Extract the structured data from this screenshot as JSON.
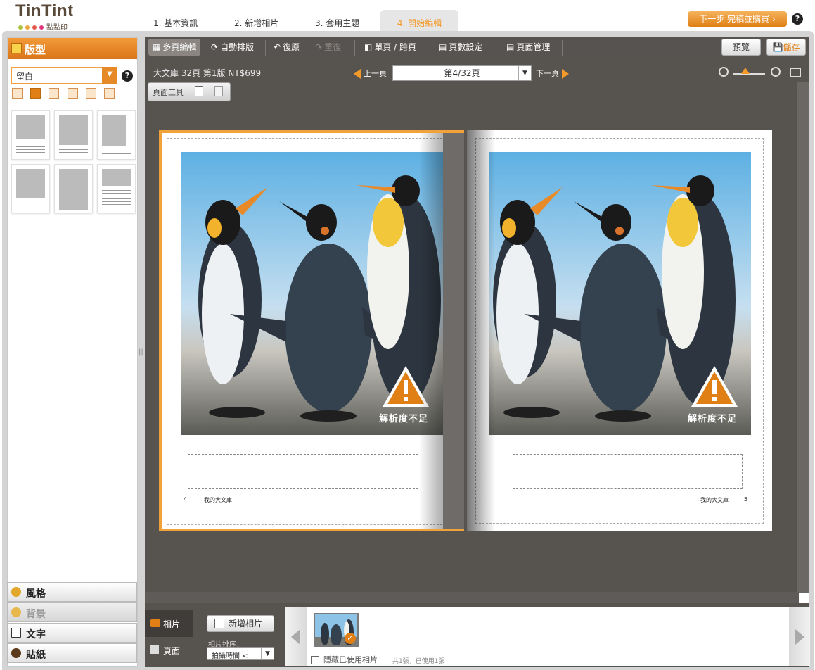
{
  "header": {
    "logo_text": "TinTint",
    "logo_sub": "點點印",
    "steps": [
      "1. 基本資訊",
      "2. 新增相片",
      "3. 套用主題",
      "4. 開始編輯"
    ],
    "next_button": "下一步 完稿並購買 ›",
    "help": "?"
  },
  "left_panel": {
    "title": "版型",
    "layout_value": "留白",
    "help": "?",
    "accordion": [
      "風格",
      "背景",
      "文字",
      "貼紙"
    ]
  },
  "toolbar": {
    "multi_edit": "多頁編輯",
    "auto_layout": "自動排版",
    "undo": "復原",
    "redo": "重復",
    "single_spread": "單頁 / 跨頁",
    "page_count": "頁數設定",
    "page_manage": "頁面管理",
    "preview": "預覽",
    "save": "儲存"
  },
  "canvas": {
    "book_info": "大文庫 32頁 第1版 NT$699",
    "prev_page": "上一頁",
    "next_page": "下一頁",
    "page_selector": "第4/32頁",
    "page_tools": "頁面工具",
    "left_page": {
      "number": "4",
      "caption": "我的大文庫",
      "warning": "解析度不足"
    },
    "right_page": {
      "number": "5",
      "caption": "我的大文庫",
      "warning": "解析度不足"
    }
  },
  "bottom": {
    "tab_photos": "相片",
    "tab_pages": "頁面",
    "add_photo": "新增相片",
    "sort_label": "相片排序：",
    "sort_value": "拍攝時間 <",
    "hide_used": "隱藏已使用相片",
    "used_count": "共1張，已使用1張"
  },
  "colors": {
    "accent": "#f39a2a",
    "workspace": "#57534f",
    "selection_border": "#f2a23a"
  }
}
